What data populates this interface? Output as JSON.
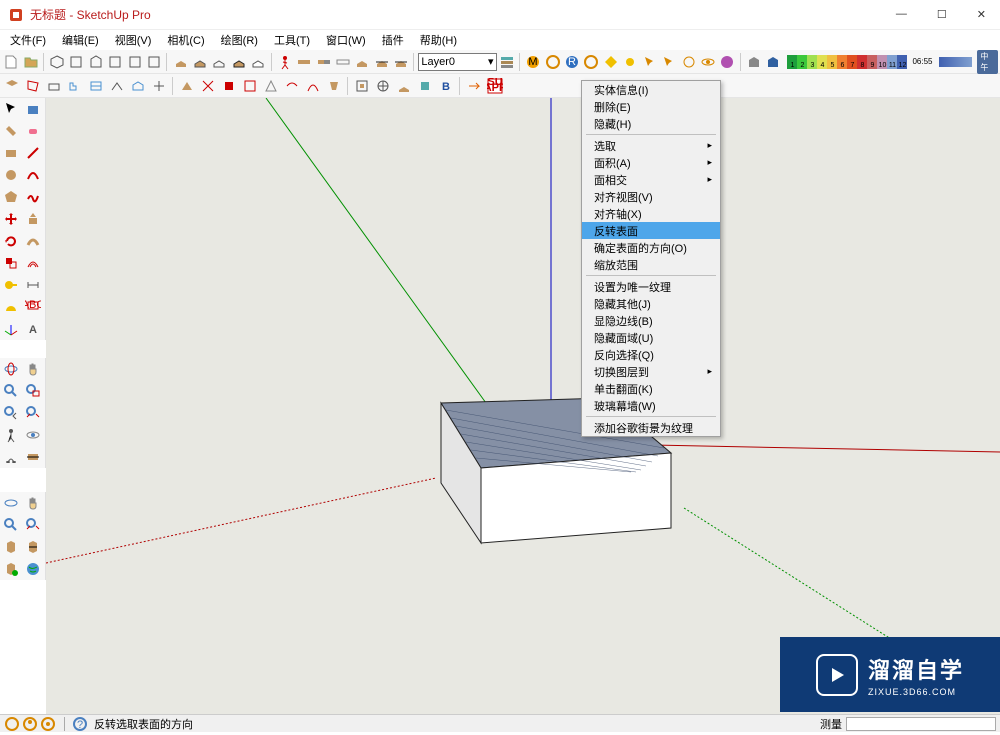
{
  "titlebar": {
    "title": "无标题 - SketchUp Pro"
  },
  "menubar": {
    "items": [
      "文件(F)",
      "编辑(E)",
      "视图(V)",
      "相机(C)",
      "绘图(R)",
      "工具(T)",
      "窗口(W)",
      "插件",
      "帮助(H)"
    ]
  },
  "toolbar1": {
    "layer_current": "Layer0",
    "time_label": "06:55",
    "period_label": "中午",
    "color_numbers": [
      "1",
      "2",
      "3",
      "4",
      "5",
      "6",
      "7",
      "8",
      "9",
      "10",
      "11",
      "12"
    ]
  },
  "context_menu": {
    "group1": [
      "实体信息(I)",
      "删除(E)",
      "隐藏(H)"
    ],
    "select_label": "选取",
    "area_label": "面积(A)",
    "intersect_label": "面相交",
    "align_view": "对齐视图(V)",
    "align_axis": "对齐轴(X)",
    "reverse_faces": "反转表面",
    "orient_faces": "确定表面的方向(O)",
    "zoom_extents": "缩放范围",
    "make_unique_texture": "设置为唯一纹理",
    "hide_rest": "隐藏其他(J)",
    "show_edges": "显隐边线(B)",
    "hide_face_region": "隐藏面域(U)",
    "invert_selection": "反向选择(Q)",
    "switch_layer": "切换图层到",
    "click_flip": "单击翻面(K)",
    "curtain_wall": "玻璃幕墙(W)",
    "add_streetview": "添加谷歌街景为纹理"
  },
  "status": {
    "hint": "反转选取表面的方向",
    "measure_label": "测量"
  },
  "watermark": {
    "main": "溜溜自学",
    "sub": "ZIXUE.3D66.COM"
  }
}
